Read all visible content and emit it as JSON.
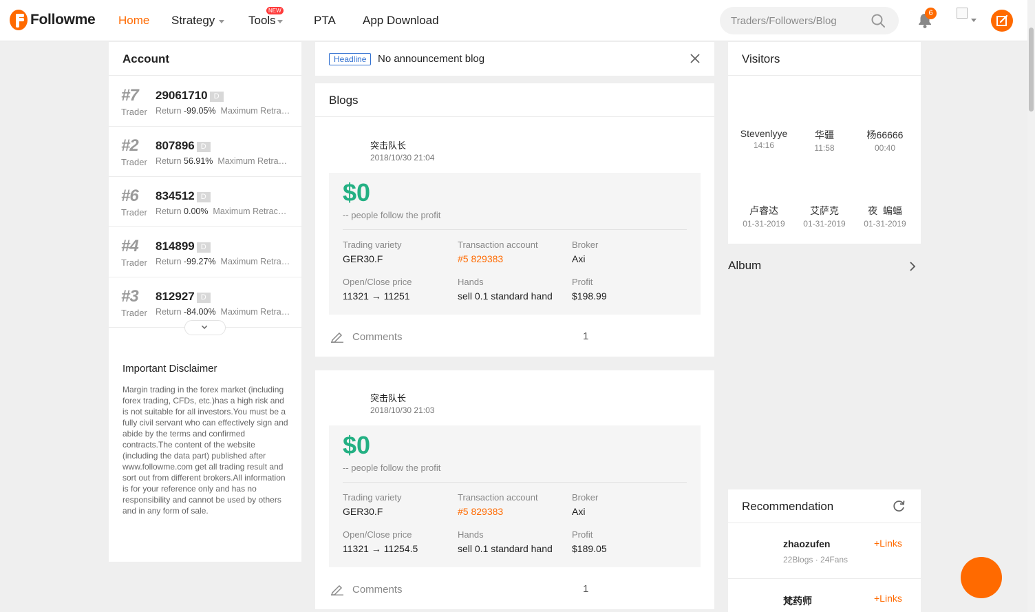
{
  "brand": {
    "name": "Followme",
    "accent": "#ff6a00",
    "profit_color": "#23b083"
  },
  "nav": {
    "home": "Home",
    "strategy": "Strategy",
    "tools": "Tools",
    "tools_badge": "NEW",
    "pta": "PTA",
    "app_download": "App Download"
  },
  "search": {
    "placeholder": "Traders/Followers/Blog"
  },
  "notifications": {
    "count": "6"
  },
  "account": {
    "title": "Account",
    "items": [
      {
        "rank": "#7",
        "id": "29061710",
        "tag": "D",
        "role": "Trader",
        "return_label": "Return",
        "return_value": "-99.05%",
        "extra": "Maximum Retracement"
      },
      {
        "rank": "#2",
        "id": "807896",
        "tag": "D",
        "role": "Trader",
        "return_label": "Return",
        "return_value": "56.91%",
        "extra": "Maximum Retracement"
      },
      {
        "rank": "#6",
        "id": "834512",
        "tag": "D",
        "role": "Trader",
        "return_label": "Return",
        "return_value": "0.00%",
        "extra": "Maximum Retracement"
      },
      {
        "rank": "#4",
        "id": "814899",
        "tag": "D",
        "role": "Trader",
        "return_label": "Return",
        "return_value": "-99.27%",
        "extra": "Maximum Retracement"
      },
      {
        "rank": "#3",
        "id": "812927",
        "tag": "D",
        "role": "Trader",
        "return_label": "Return",
        "return_value": "-84.00%",
        "extra": "Maximum Retracement"
      }
    ]
  },
  "disclaimer": {
    "title": "Important Disclaimer",
    "text": "Margin trading in the forex market (including forex trading, CFDs, etc.)has a high risk and is not suitable for all investors.You must be a fully civil servant who can effectively sign and abide by the terms and confirmed contracts.The content of the website (including the data part) published after www.followme.com get all trading result and sort out from different brokers.All information is for your reference only and has no responsibility and cannot be used by others and in any form of sale."
  },
  "headline": {
    "tag": "Headline",
    "text": "No announcement blog"
  },
  "blogs": {
    "title": "Blogs",
    "posts": [
      {
        "author": "突击队长",
        "date": "2018/10/30 21:04",
        "profit": "$0",
        "profit_sub": "-- people follow the profit",
        "labels": {
          "variety": "Trading variety",
          "account": "Transaction account",
          "broker": "Broker",
          "price": "Open/Close price",
          "hands": "Hands",
          "profit": "Profit"
        },
        "variety": "GER30.F",
        "account": "#5 829383",
        "broker": "Axi",
        "price": "11321 → 11251",
        "hands": "sell 0.1 standard hand",
        "profit_value": "$198.99",
        "comments_label": "Comments",
        "comments_count": "1"
      },
      {
        "author": "突击队长",
        "date": "2018/10/30 21:03",
        "profit": "$0",
        "profit_sub": "-- people follow the profit",
        "labels": {
          "variety": "Trading variety",
          "account": "Transaction account",
          "broker": "Broker",
          "price": "Open/Close price",
          "hands": "Hands",
          "profit": "Profit"
        },
        "variety": "GER30.F",
        "account": "#5 829383",
        "broker": "Axi",
        "price": "11321 → 11254.5",
        "hands": "sell 0.1 standard hand",
        "profit_value": "$189.05",
        "comments_label": "Comments",
        "comments_count": "1"
      }
    ]
  },
  "visitors": {
    "title": "Visitors",
    "items": [
      {
        "name": "Stevenlyye",
        "time": "14:16"
      },
      {
        "name": "华疆",
        "time": "11:58"
      },
      {
        "name": "杨66666",
        "time": "00:40"
      },
      {
        "name": "卢睿达",
        "time": "01-31-2019"
      },
      {
        "name": "艾萨克",
        "time": "01-31-2019"
      },
      {
        "name": "夜  蝙蝠",
        "time": "01-31-2019"
      }
    ]
  },
  "album": {
    "title": "Album"
  },
  "recommendation": {
    "title": "Recommendation",
    "items": [
      {
        "name": "zhaozufen",
        "meta": "22Blogs · 24Fans",
        "link": "+Links"
      },
      {
        "name": "梵药师",
        "meta": "",
        "link": "+Links"
      }
    ]
  }
}
